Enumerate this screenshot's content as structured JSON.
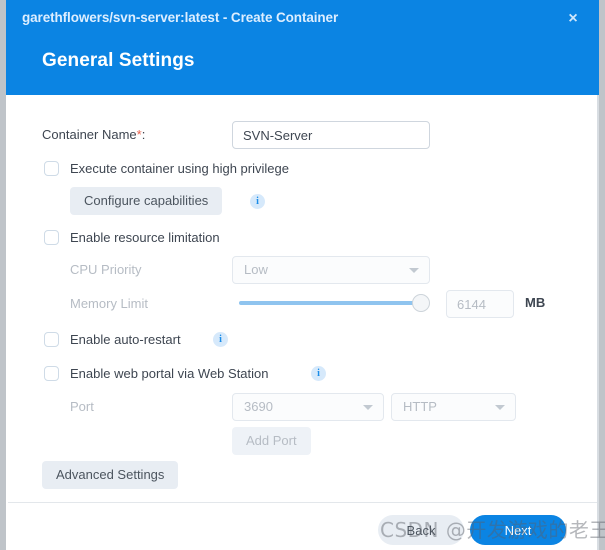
{
  "window": {
    "title": "garethflowers/svn-server:latest - Create Container",
    "close_label": "×"
  },
  "panel": {
    "heading": "General Settings"
  },
  "form": {
    "container_name": {
      "label": "Container Name",
      "required_mark": "*",
      "colon": ":",
      "value": "SVN-Server"
    },
    "high_privilege": {
      "label": "Execute container using high privilege",
      "checked": false
    },
    "configure_capabilities": {
      "label": "Configure capabilities",
      "info_icon": "info-icon",
      "info_glyph": "i"
    },
    "resource_limitation": {
      "label": "Enable resource limitation",
      "checked": false
    },
    "cpu_priority": {
      "label": "CPU Priority",
      "value": "Low",
      "caret_icon": "chevron-down-icon"
    },
    "memory_limit": {
      "label": "Memory Limit",
      "value": "6144",
      "unit": "MB",
      "slider_percent": 100
    },
    "auto_restart": {
      "label": "Enable auto-restart",
      "checked": false,
      "info_glyph": "i"
    },
    "web_portal": {
      "label": "Enable web portal via Web Station",
      "checked": false,
      "info_glyph": "i"
    },
    "port": {
      "label": "Port",
      "number_value": "3690",
      "protocol_value": "HTTP",
      "add_port_label": "Add Port"
    },
    "advanced_settings": {
      "label": "Advanced Settings"
    }
  },
  "footer": {
    "back_label": "Back",
    "next_label": "Next"
  },
  "overlay": {
    "watermark": "CSDN @开发游戏的老王"
  },
  "colors": {
    "accent": "#0b84e3",
    "header_bg": "#0b84e3",
    "required_star": "#e8604c",
    "text": "#3e4651",
    "disabled_text": "#b6bcc4",
    "button_grey": "#e8edf3",
    "slider_track": "#8fc4ef",
    "info_bg": "#d6e9fb"
  }
}
